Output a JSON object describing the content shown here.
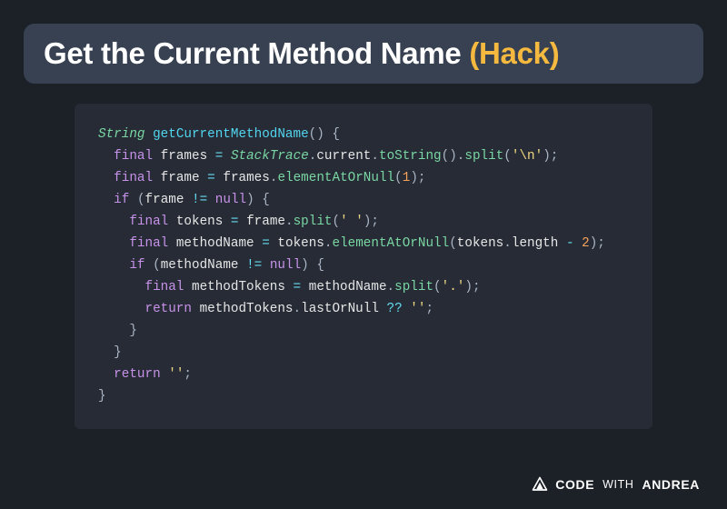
{
  "title": {
    "main": "Get the Current Method Name ",
    "hack": "(Hack)"
  },
  "code": {
    "l1": {
      "ret": "String",
      "fn": "getCurrentMethodName",
      "paren": "() {",
      "sp": " "
    },
    "l2": {
      "kw": "final",
      "var": "frames",
      "eq": "=",
      "cls": "StackTrace",
      "dot1": ".",
      "p1": "current",
      "dot2": ".",
      "c1": "toString",
      "par1": "().",
      "c2": "split",
      "par2": "(",
      "str": "'\\n'",
      "par3": ");",
      "sp": " "
    },
    "l3": {
      "kw": "final",
      "var": "frame",
      "eq": "=",
      "obj": "frames",
      "dot": ".",
      "call": "elementAtOrNull",
      "par1": "(",
      "num": "1",
      "par2": ");",
      "sp": " "
    },
    "l4": {
      "kw": "if",
      "par1": "(",
      "var": "frame",
      "op": "!=",
      "null": "null",
      "par2": ") {",
      "sp": " "
    },
    "l5": {
      "kw": "final",
      "var": "tokens",
      "eq": "=",
      "obj": "frame",
      "dot": ".",
      "call": "split",
      "par1": "(",
      "str": "' '",
      "par2": ");",
      "sp": " "
    },
    "l6": {
      "kw": "final",
      "var": "methodName",
      "eq": "=",
      "obj": "tokens",
      "dot": ".",
      "call": "elementAtOrNull",
      "par1": "(",
      "obj2": "tokens",
      "dot2": ".",
      "prop": "length",
      "op": "-",
      "num": "2",
      "par2": ");",
      "sp": " "
    },
    "l7": {
      "kw": "if",
      "par1": "(",
      "var": "methodName",
      "op": "!=",
      "null": "null",
      "par2": ") {",
      "sp": " "
    },
    "l8": {
      "kw": "final",
      "var": "methodTokens",
      "eq": "=",
      "obj": "methodName",
      "dot": ".",
      "call": "split",
      "par1": "(",
      "str": "'.'",
      "par2": ");",
      "sp": " "
    },
    "l9": {
      "kw": "return",
      "obj": "methodTokens",
      "dot": ".",
      "prop": "lastOrNull",
      "op": "??",
      "str": "''",
      "semi": ";",
      "sp": " "
    },
    "l10": {
      "brace": "}"
    },
    "l11": {
      "brace": "}"
    },
    "l12": {
      "kw": "return",
      "str": "''",
      "semi": ";",
      "sp": " "
    },
    "l13": {
      "brace": "}"
    }
  },
  "brand": {
    "code": "CODE",
    "with": "WITH",
    "name": "ANDREA"
  }
}
